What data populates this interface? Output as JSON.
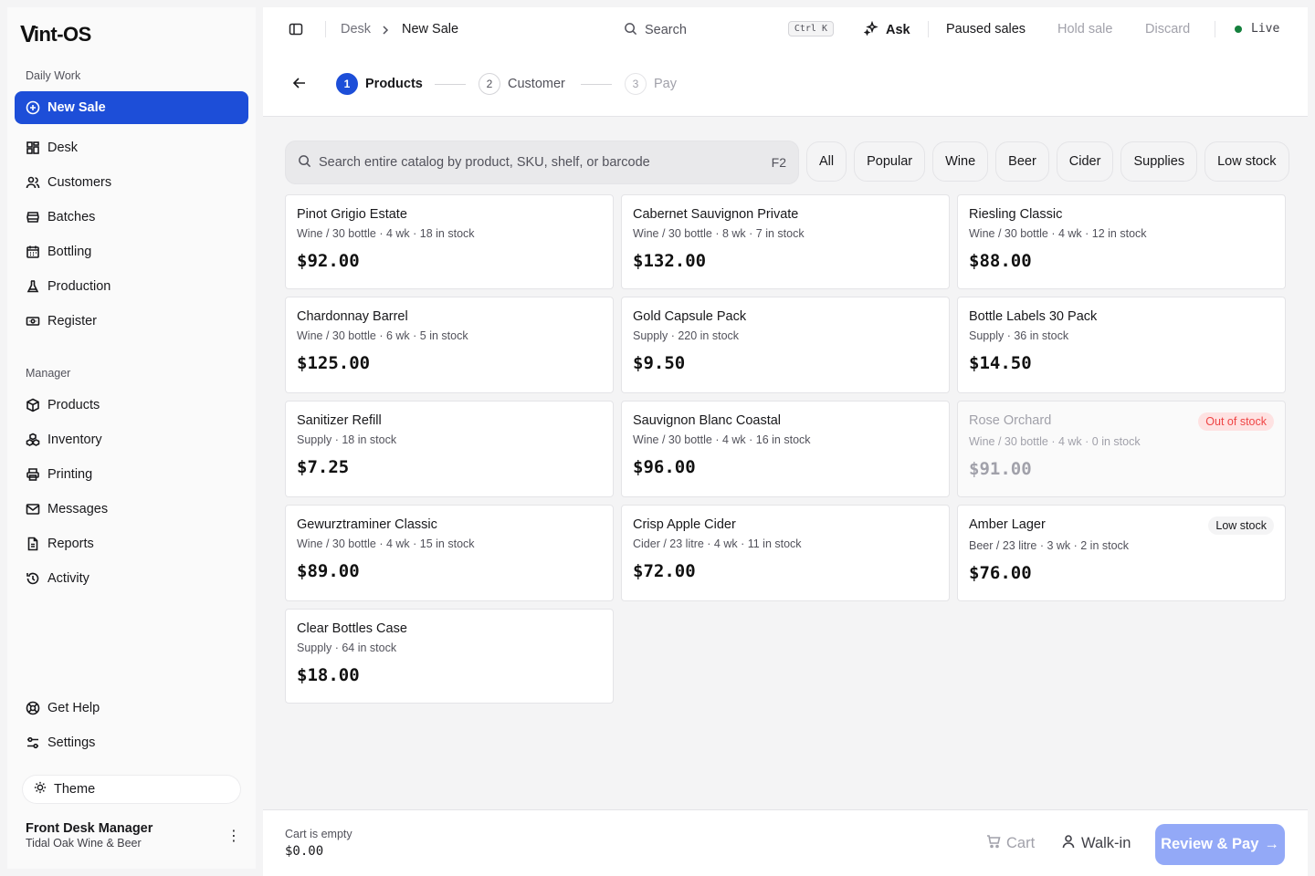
{
  "app": {
    "logo_v": "V",
    "logo_rest": "int-OS"
  },
  "sidebar": {
    "daily_title": "Daily Work",
    "daily_items": [
      {
        "label": "New Sale",
        "icon": "plus-circle-icon"
      },
      {
        "label": "Desk",
        "icon": "dashboard-icon"
      },
      {
        "label": "Customers",
        "icon": "users-icon"
      },
      {
        "label": "Batches",
        "icon": "barrel-icon"
      },
      {
        "label": "Bottling",
        "icon": "calendar-icon"
      },
      {
        "label": "Production",
        "icon": "flask-icon"
      },
      {
        "label": "Register",
        "icon": "cash-icon"
      }
    ],
    "manager_title": "Manager",
    "manager_items": [
      {
        "label": "Products",
        "icon": "box-icon"
      },
      {
        "label": "Inventory",
        "icon": "boxes-icon"
      },
      {
        "label": "Printing",
        "icon": "printer-icon"
      },
      {
        "label": "Messages",
        "icon": "mail-icon"
      },
      {
        "label": "Reports",
        "icon": "report-icon"
      },
      {
        "label": "Activity",
        "icon": "history-icon"
      }
    ],
    "help_label": "Get Help",
    "settings_label": "Settings",
    "theme_label": "Theme",
    "user_name": "Front Desk Manager",
    "user_org": "Tidal Oak Wine & Beer"
  },
  "header": {
    "breadcrumb_1": "Desk",
    "breadcrumb_sep": ">",
    "breadcrumb_2": "New Sale",
    "search_placeholder": "Search",
    "search_shortcut": "Ctrl K",
    "ask_label": "Ask",
    "paused_sales": "Paused sales",
    "hold_sale": "Hold sale",
    "discard": "Discard",
    "live_label": "Live"
  },
  "steps": [
    {
      "num": "1",
      "label": "Products"
    },
    {
      "num": "2",
      "label": "Customer"
    },
    {
      "num": "3",
      "label": "Pay"
    }
  ],
  "catalog": {
    "search_placeholder": "Search entire catalog by product, SKU, shelf, or barcode",
    "search_shortcut": "F2",
    "filters": [
      "All",
      "Popular",
      "Wine",
      "Beer",
      "Cider",
      "Supplies",
      "Low stock"
    ]
  },
  "products": [
    {
      "name": "Pinot Grigio Estate",
      "meta": "Wine / 30 bottle · 4 wk · 18 in stock",
      "price": "$92.00"
    },
    {
      "name": "Cabernet Sauvignon Private",
      "meta": "Wine / 30 bottle · 8 wk · 7 in stock",
      "price": "$132.00"
    },
    {
      "name": "Riesling Classic",
      "meta": "Wine / 30 bottle · 4 wk · 12 in stock",
      "price": "$88.00"
    },
    {
      "name": "Chardonnay Barrel",
      "meta": "Wine / 30 bottle · 6 wk · 5 in stock",
      "price": "$125.00"
    },
    {
      "name": "Gold Capsule Pack",
      "meta": "Supply · 220 in stock",
      "price": "$9.50"
    },
    {
      "name": "Bottle Labels 30 Pack",
      "meta": "Supply · 36 in stock",
      "price": "$14.50"
    },
    {
      "name": "Sanitizer Refill",
      "meta": "Supply · 18 in stock",
      "price": "$7.25"
    },
    {
      "name": "Sauvignon Blanc Coastal",
      "meta": "Wine / 30 bottle · 4 wk · 16 in stock",
      "price": "$96.00"
    },
    {
      "name": "Rose Orchard",
      "meta": "Wine / 30 bottle · 4 wk · 0 in stock",
      "price": "$91.00",
      "badge": "Out of stock"
    },
    {
      "name": "Gewurztraminer Classic",
      "meta": "Wine / 30 bottle · 4 wk · 15 in stock",
      "price": "$89.00"
    },
    {
      "name": "Crisp Apple Cider",
      "meta": "Cider / 23 litre · 4 wk · 11 in stock",
      "price": "$72.00"
    },
    {
      "name": "Amber Lager",
      "meta": "Beer / 23 litre · 3 wk · 2 in stock",
      "price": "$76.00",
      "badge": "Low stock"
    },
    {
      "name": "Clear Bottles Case",
      "meta": "Supply · 64 in stock",
      "price": "$18.00"
    }
  ],
  "footer": {
    "cart_status": "Cart is empty",
    "cart_total": "$0.00",
    "cart_label": "Cart",
    "walkin_label": "Walk-in",
    "review_label": "Review & Pay",
    "review_arrow": "→"
  },
  "colors": {
    "accent": "#1d4ed8",
    "review_button": "#93a9f7",
    "live_dot": "#15803d",
    "out_of_stock": "#ef4444"
  }
}
